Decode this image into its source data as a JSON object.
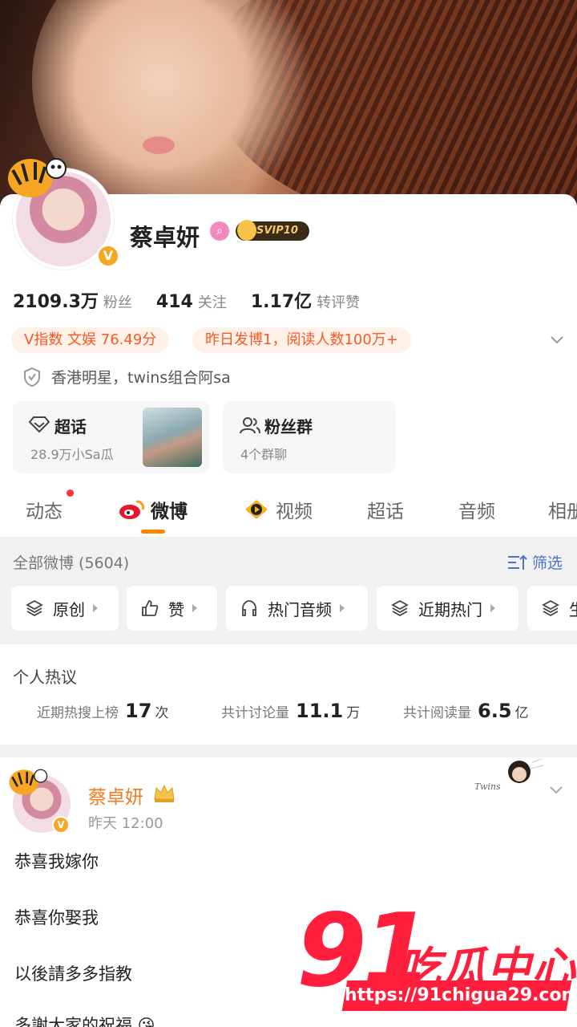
{
  "profile": {
    "name": "蔡卓妍",
    "svip": "SVIP10",
    "verify_badge": "V",
    "stats": [
      {
        "num": "2109.3万",
        "label": "粉丝"
      },
      {
        "num": "414",
        "label": "关注"
      },
      {
        "num": "1.17亿",
        "label": "转评赞"
      }
    ],
    "tags": [
      "V指数 文娱 76.49分",
      "昨日发博1，阅读人数100万+"
    ],
    "verify_text": "香港明星，twins组合阿sa",
    "super_topic": {
      "title": "超话",
      "sub": "28.9万小Sa瓜"
    },
    "fan_group": {
      "title": "粉丝群",
      "sub": "4个群聊"
    }
  },
  "tabs": [
    "动态",
    "微博",
    "视频",
    "超话",
    "音频",
    "相册"
  ],
  "filter": {
    "all_label": "全部微博 (5604)",
    "filter_label": "筛选",
    "chips": [
      "原创",
      "赞",
      "热门音频",
      "近期热门",
      "生"
    ]
  },
  "hot": {
    "title": "个人热议",
    "items": [
      {
        "label": "近期热搜上榜",
        "num": "17",
        "unit": "次"
      },
      {
        "label": "共计讨论量",
        "num": "11.1",
        "unit": "万"
      },
      {
        "label": "共计阅读量",
        "num": "6.5",
        "unit": "亿"
      }
    ]
  },
  "post": {
    "author": "蔡卓妍",
    "badge": "V",
    "time": "昨天 12:00",
    "sticker_text": "Twins",
    "lines": [
      "恭喜我嫁你",
      "恭喜你娶我",
      "以後請多多指教",
      "多謝大家的祝福 😘"
    ]
  },
  "watermark": {
    "brand_num": "91",
    "brand_cn": "吃瓜中心",
    "url": "https://91chigua29.com"
  },
  "colors": {
    "accent_orange": "#ff8200",
    "tag_text": "#f25b27",
    "link_blue": "#4a74c9",
    "watermark_red": "#ff1e3c"
  }
}
